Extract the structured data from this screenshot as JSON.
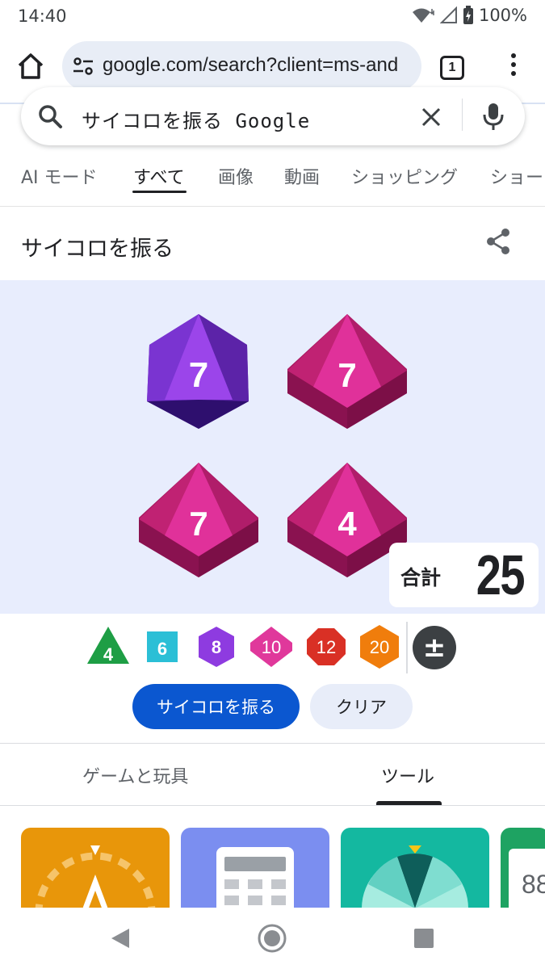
{
  "status_bar": {
    "time": "14:40",
    "battery": "100%"
  },
  "browser": {
    "url": "google.com/search?client=ms-and",
    "tab_count": "1"
  },
  "search": {
    "query": "サイコロを振る Google"
  },
  "search_tabs": [
    {
      "label": "AI モード",
      "active": false
    },
    {
      "label": "すべて",
      "active": true
    },
    {
      "label": "画像",
      "active": false
    },
    {
      "label": "動画",
      "active": false
    },
    {
      "label": "ショッピング",
      "active": false
    },
    {
      "label": "ショー",
      "active": false
    }
  ],
  "dice_card": {
    "title": "サイコロを振る",
    "dice": [
      {
        "type": "d8",
        "color": "#8e3be0",
        "value": "7"
      },
      {
        "type": "d10",
        "color": "#d62e88",
        "value": "7"
      },
      {
        "type": "d10",
        "color": "#d62e88",
        "value": "7"
      },
      {
        "type": "d10",
        "color": "#d62e88",
        "value": "4"
      }
    ],
    "total_label": "合計",
    "total_value": "25",
    "selectors": [
      {
        "label": "4",
        "color": "#1e9e45"
      },
      {
        "label": "6",
        "color": "#2bbfd6"
      },
      {
        "label": "8",
        "color": "#8e3be0"
      },
      {
        "label": "10",
        "color": "#e0389b"
      },
      {
        "label": "12",
        "color": "#d93025"
      },
      {
        "label": "20",
        "color": "#f07d0c"
      },
      {
        "label": "±",
        "color": "#3c4043"
      }
    ],
    "roll_button": "サイコロを振る",
    "clear_button": "クリア"
  },
  "categories": {
    "tab1": "ゲームと玩具",
    "tab2": "ツール"
  },
  "tool_cards": {
    "card4_text": "88"
  },
  "colors": {
    "accent": "#0b57d0",
    "dice_bg": "#e8edfd"
  }
}
